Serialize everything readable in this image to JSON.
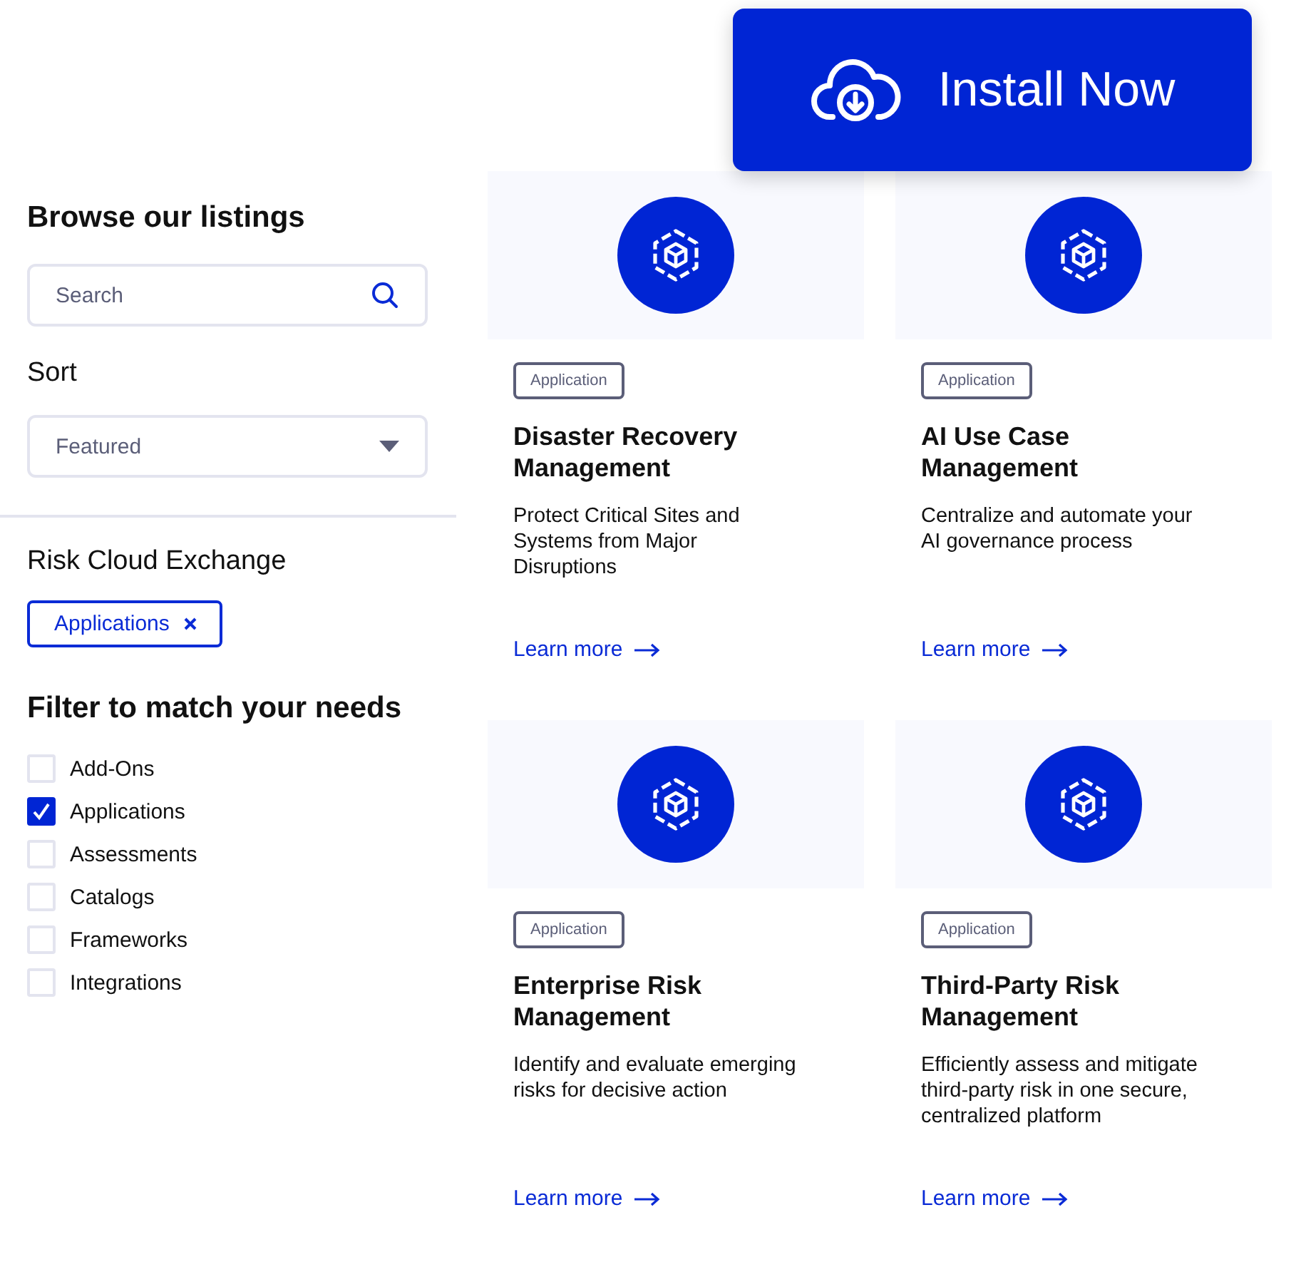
{
  "install_button": {
    "label": "Install Now"
  },
  "sidebar": {
    "title": "Browse our listings",
    "search": {
      "placeholder": "Search"
    },
    "sort": {
      "label": "Sort",
      "value": "Featured"
    },
    "exchange": {
      "title": "Risk Cloud Exchange",
      "chips": [
        {
          "label": "Applications"
        }
      ]
    },
    "filter": {
      "title": "Filter to match your needs",
      "options": [
        {
          "label": "Add-Ons",
          "checked": false
        },
        {
          "label": "Applications",
          "checked": true
        },
        {
          "label": "Assessments",
          "checked": false
        },
        {
          "label": "Catalogs",
          "checked": false
        },
        {
          "label": "Frameworks",
          "checked": false
        },
        {
          "label": "Integrations",
          "checked": false
        }
      ]
    }
  },
  "cards": [
    {
      "tag": "Application",
      "title": "Disaster Recovery Management",
      "description": "Protect Critical Sites and Systems from Major Disruptions",
      "link": "Learn more"
    },
    {
      "tag": "Application",
      "title": "AI Use Case Management",
      "description": "Centralize and automate your AI governance process",
      "link": "Learn more"
    },
    {
      "tag": "Application",
      "title": "Enterprise Risk Management",
      "description": "Identify and evaluate emerging risks for decisive action",
      "link": "Learn more"
    },
    {
      "tag": "Application",
      "title": "Third-Party Risk Management",
      "description": "Efficiently assess and mitigate third-party risk in one secure, centralized platform",
      "link": "Learn more"
    }
  ]
}
